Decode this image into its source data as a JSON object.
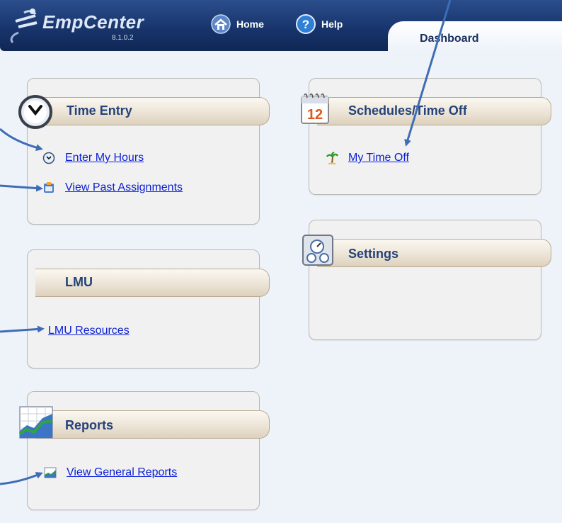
{
  "app": {
    "name": "EmpCenter",
    "version": "8.1.0.2"
  },
  "header": {
    "home_label": "Home",
    "help_label": "Help",
    "tab_label": "Dashboard"
  },
  "panels": {
    "time_entry": {
      "title": "Time Entry",
      "links": [
        {
          "label": "Enter My Hours",
          "icon": "clock-icon"
        },
        {
          "label": "View Past Assignments",
          "icon": "calendar-briefcase-icon"
        }
      ]
    },
    "schedules": {
      "title": "Schedules/Time Off",
      "links": [
        {
          "label": "My Time Off",
          "icon": "palm-tree-icon"
        }
      ]
    },
    "settings": {
      "title": "Settings",
      "links": []
    },
    "lmu": {
      "title": "LMU",
      "links": [
        {
          "label": "LMU Resources"
        }
      ]
    },
    "reports": {
      "title": "Reports",
      "links": [
        {
          "label": "View General Reports",
          "icon": "chart-icon"
        }
      ]
    }
  },
  "colors": {
    "header": "#18356d",
    "link": "#0b1fd6",
    "title": "#24427a",
    "arrow": "#3e6db5"
  }
}
